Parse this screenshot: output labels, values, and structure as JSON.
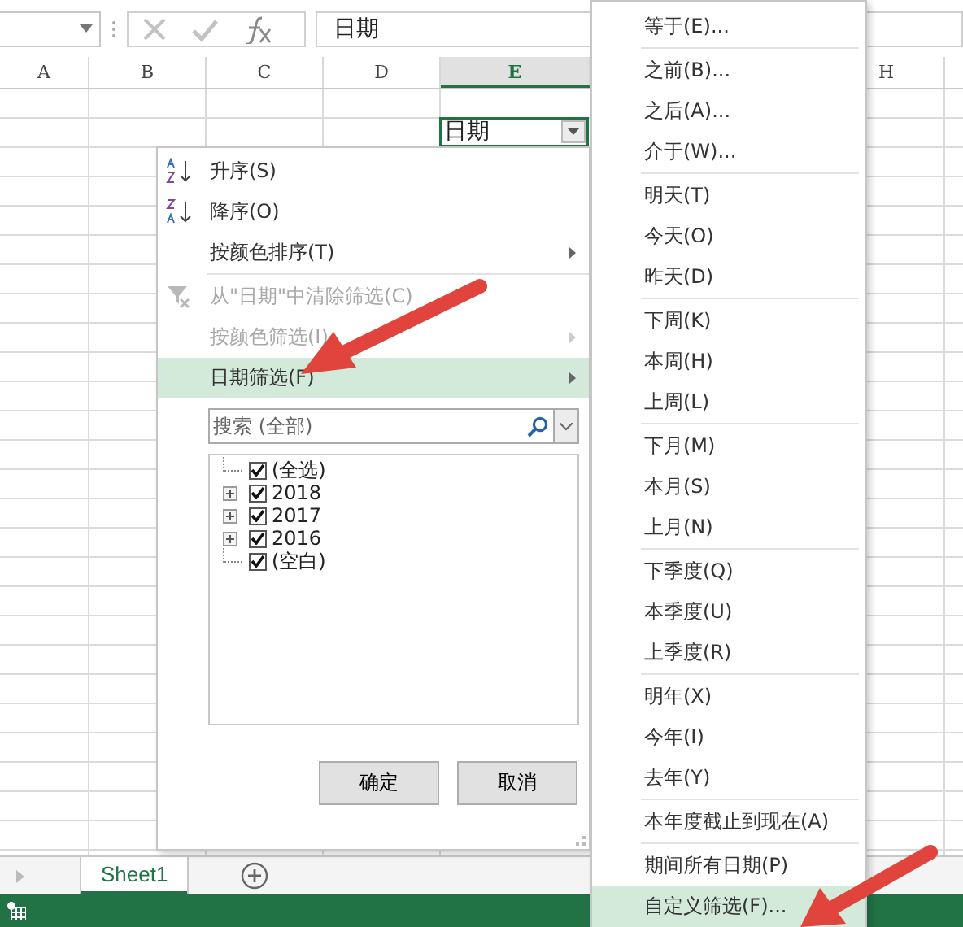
{
  "formula_bar": {
    "formula": "日期"
  },
  "columns": [
    {
      "label": "A",
      "selected": false
    },
    {
      "label": "B",
      "selected": false
    },
    {
      "label": "C",
      "selected": false
    },
    {
      "label": "D",
      "selected": false
    },
    {
      "label": "E",
      "selected": true
    },
    {
      "label": "H",
      "selected": false
    }
  ],
  "active_cell": {
    "value": "日期",
    "filter": true
  },
  "filter_menu": {
    "groups": [
      [
        {
          "kind": "sort_asc",
          "label": "升序(S)",
          "disabled": false,
          "submenu": false,
          "selected": false
        },
        {
          "kind": "sort_desc",
          "label": "降序(O)",
          "disabled": false,
          "submenu": false,
          "selected": false
        },
        {
          "kind": "plain",
          "label": "按颜色排序(T)",
          "disabled": false,
          "submenu": true,
          "selected": false
        }
      ],
      [
        {
          "kind": "clear_filter",
          "label": "从\"日期\"中清除筛选(C)",
          "disabled": true,
          "submenu": false,
          "selected": false
        },
        {
          "kind": "plain",
          "label": "按颜色筛选(I)",
          "disabled": true,
          "submenu": true,
          "selected": false
        },
        {
          "kind": "plain",
          "label": "日期筛选(F)",
          "disabled": false,
          "submenu": true,
          "selected": true
        }
      ]
    ],
    "search": {
      "placeholder": "搜索 (全部)"
    },
    "tree": [
      {
        "kind": "leaf",
        "label": "(全选)",
        "checked": true
      },
      {
        "kind": "node",
        "label": "2018",
        "checked": true,
        "expanded": false
      },
      {
        "kind": "node",
        "label": "2017",
        "checked": true,
        "expanded": false
      },
      {
        "kind": "node",
        "label": "2016",
        "checked": true,
        "expanded": false
      },
      {
        "kind": "leaf",
        "label": "(空白)",
        "checked": true
      }
    ],
    "buttons": [
      "确定",
      "取消"
    ]
  },
  "date_submenu": {
    "groups": [
      [
        {
          "label": "等于(E)...",
          "selected": false
        }
      ],
      [
        {
          "label": "之前(B)...",
          "selected": false
        },
        {
          "label": "之后(A)...",
          "selected": false
        },
        {
          "label": "介于(W)...",
          "selected": false
        }
      ],
      [
        {
          "label": "明天(T)",
          "selected": false
        },
        {
          "label": "今天(O)",
          "selected": false
        },
        {
          "label": "昨天(D)",
          "selected": false
        }
      ],
      [
        {
          "label": "下周(K)",
          "selected": false
        },
        {
          "label": "本周(H)",
          "selected": false
        },
        {
          "label": "上周(L)",
          "selected": false
        }
      ],
      [
        {
          "label": "下月(M)",
          "selected": false
        },
        {
          "label": "本月(S)",
          "selected": false
        },
        {
          "label": "上月(N)",
          "selected": false
        }
      ],
      [
        {
          "label": "下季度(Q)",
          "selected": false
        },
        {
          "label": "本季度(U)",
          "selected": false
        },
        {
          "label": "上季度(R)",
          "selected": false
        }
      ],
      [
        {
          "label": "明年(X)",
          "selected": false
        },
        {
          "label": "今年(I)",
          "selected": false
        },
        {
          "label": "去年(Y)",
          "selected": false
        }
      ],
      [
        {
          "label": "本年度截止到现在(A)",
          "selected": false
        }
      ],
      [
        {
          "label": "期间所有日期(P)",
          "selected": false
        },
        {
          "label": "自定义筛选(F)...",
          "selected": true
        }
      ]
    ]
  },
  "sheet_tabs": [
    {
      "label": "Sheet1",
      "selected": true
    }
  ],
  "annotations": [
    {
      "kind": "arrow"
    },
    {
      "kind": "arrow"
    }
  ]
}
